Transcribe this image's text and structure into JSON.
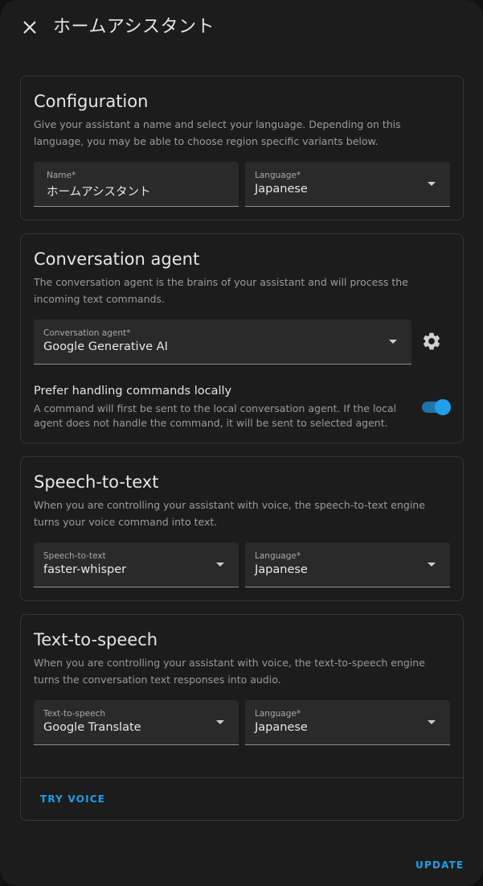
{
  "dialog": {
    "title": "ホームアシスタント",
    "close_icon": "close-icon"
  },
  "configuration": {
    "title": "Configuration",
    "description": "Give your assistant a name and select your language. Depending on this language, you may be able to choose region specific variants below.",
    "name_field": {
      "label": "Name*",
      "value": "ホームアシスタント"
    },
    "language_field": {
      "label": "Language*",
      "value": "Japanese"
    }
  },
  "conversation": {
    "title": "Conversation agent",
    "description": "The conversation agent is the brains of your assistant and will process the incoming text commands.",
    "agent_field": {
      "label": "Conversation agent*",
      "value": "Google Generative AI"
    },
    "settings_icon": "gear-icon",
    "prefer_local": {
      "title": "Prefer handling commands locally",
      "description": "A command will first be sent to the local conversation agent. If the local agent does not handle the command, it will be sent to selected agent.",
      "enabled": true
    }
  },
  "stt": {
    "title": "Speech-to-text",
    "description": "When you are controlling your assistant with voice, the speech-to-text engine turns your voice command into text.",
    "engine_field": {
      "label": "Speech-to-text",
      "value": "faster-whisper"
    },
    "language_field": {
      "label": "Language*",
      "value": "Japanese"
    }
  },
  "tts": {
    "title": "Text-to-speech",
    "description": "When you are controlling your assistant with voice, the text-to-speech engine turns the conversation text responses into audio.",
    "engine_field": {
      "label": "Text-to-speech",
      "value": "Google Translate"
    },
    "language_field": {
      "label": "Language*",
      "value": "Japanese"
    },
    "try_voice_label": "TRY VOICE"
  },
  "footer": {
    "update_label": "UPDATE"
  },
  "colors": {
    "background": "#1c1c1c",
    "accent": "#1ea0ea",
    "card_border": "#363636",
    "field_background": "#2a2a2a"
  }
}
